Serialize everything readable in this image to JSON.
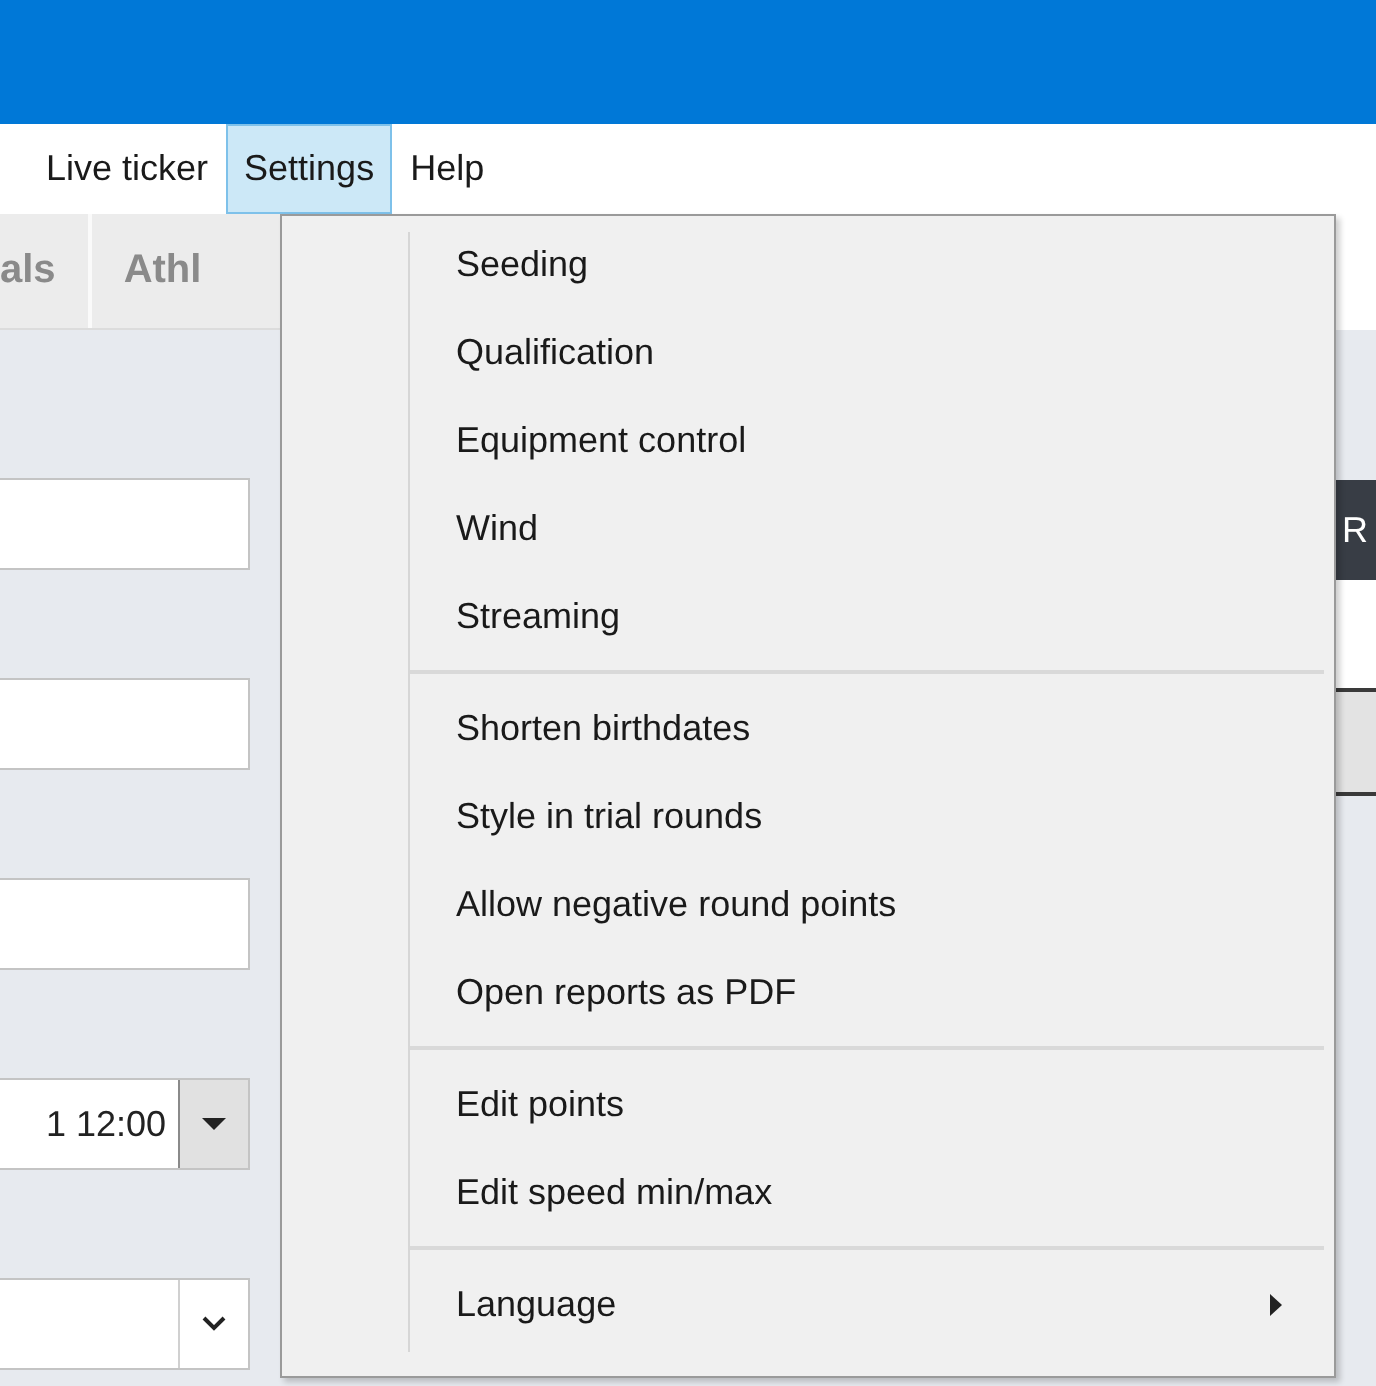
{
  "menu_bar": [
    {
      "label": "Live ticker",
      "selected": false
    },
    {
      "label": "Settings",
      "selected": true
    },
    {
      "label": "Help",
      "selected": false
    }
  ],
  "tabs": [
    {
      "label": "als"
    },
    {
      "label": "Athl"
    }
  ],
  "form": {
    "fields": [
      {
        "kind": "text"
      },
      {
        "kind": "text"
      },
      {
        "kind": "text"
      },
      {
        "kind": "datetime",
        "value": "1 12:00"
      },
      {
        "kind": "combo"
      }
    ]
  },
  "table": {
    "header": "R"
  },
  "settings_menu": {
    "groups": [
      [
        {
          "label": "Seeding",
          "submenu": false
        },
        {
          "label": "Qualification",
          "submenu": false
        },
        {
          "label": "Equipment control",
          "submenu": false
        },
        {
          "label": "Wind",
          "submenu": false
        },
        {
          "label": "Streaming",
          "submenu": false
        }
      ],
      [
        {
          "label": "Shorten birthdates",
          "submenu": false
        },
        {
          "label": "Style in trial rounds",
          "submenu": false
        },
        {
          "label": "Allow negative round points",
          "submenu": false
        },
        {
          "label": "Open reports as PDF",
          "submenu": false
        }
      ],
      [
        {
          "label": "Edit points",
          "submenu": false
        },
        {
          "label": "Edit speed min/max",
          "submenu": false
        }
      ],
      [
        {
          "label": "Language",
          "submenu": true
        }
      ]
    ]
  }
}
